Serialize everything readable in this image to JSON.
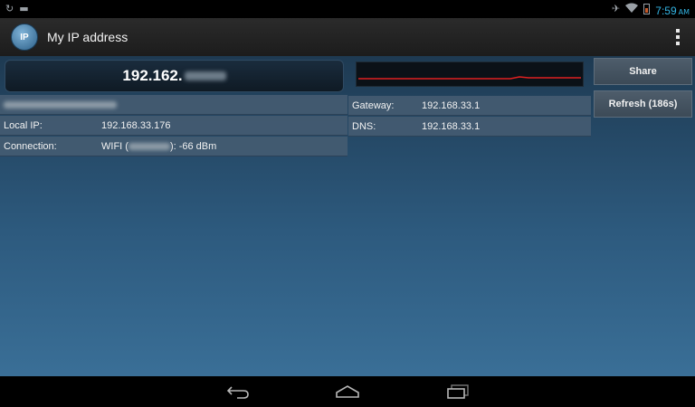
{
  "status_bar": {
    "left_icons": [
      "sync-icon",
      "notification-icon"
    ],
    "right_icons": [
      "airplane-icon",
      "wifi-icon",
      "battery-icon"
    ],
    "time": "7:59",
    "ampm": "AM"
  },
  "action_bar": {
    "app_icon_text": "IP",
    "title": "My IP address",
    "overflow_icon": "overflow-menu-icon"
  },
  "main": {
    "public_ip_visible": "192.162.",
    "signal_graph": {
      "line_color": "#e02020",
      "level": 0.68
    }
  },
  "buttons": {
    "share_label": "Share",
    "refresh_label": "Refresh (186s)"
  },
  "info": {
    "local_ip_label": "Local IP:",
    "local_ip_value": "192.168.33.176",
    "connection_label": "Connection:",
    "connection_type": "WIFI",
    "connection_open": "(",
    "connection_close": "): -66 dBm",
    "gateway_label": "Gateway:",
    "gateway_value": "192.168.33.1",
    "dns_label": "DNS:",
    "dns_value": "192.168.33.1"
  },
  "nav_bar": {
    "icons": [
      "back-icon",
      "home-icon",
      "recent-apps-icon"
    ]
  },
  "colors": {
    "accent": "#33b5e5",
    "graph_line": "#e02020"
  }
}
